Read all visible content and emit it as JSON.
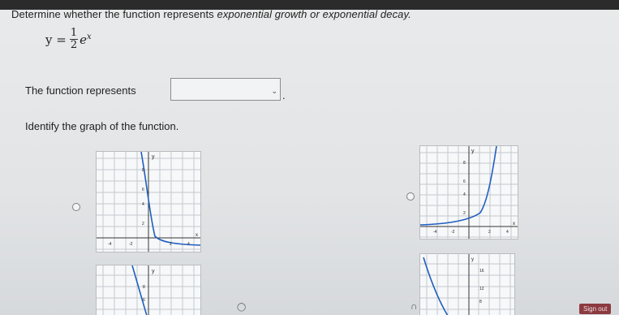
{
  "prompt": {
    "text_before": "Determine whether the function represents ",
    "text_em": "exponential growth or exponential decay."
  },
  "equation": {
    "lhs": "y =",
    "numerator": "1",
    "denominator": "2",
    "base": "e",
    "exponent": "x"
  },
  "statement": {
    "text": "The function represents",
    "answer_value": "",
    "period": "."
  },
  "identify_label": "Identify the graph of the function.",
  "graphs": [
    {
      "id": "A",
      "axis_labels": {
        "x": "x",
        "y": "y"
      },
      "y_ticks": [
        "8",
        "6",
        "4",
        "2"
      ],
      "x_ticks": [
        "-4",
        "-2",
        "2",
        "4"
      ]
    },
    {
      "id": "B",
      "axis_labels": {
        "x": "x",
        "y": "y"
      },
      "y_ticks": [
        "8",
        "6",
        "4",
        "2"
      ],
      "x_ticks": [
        "-4",
        "-2",
        "2",
        "4"
      ]
    },
    {
      "id": "C",
      "axis_labels": {
        "y": "y"
      },
      "y_ticks": [
        "8",
        "6"
      ]
    },
    {
      "id": "D",
      "axis_labels": {
        "y": "y"
      },
      "y_ticks": [
        "16",
        "12",
        "8"
      ]
    }
  ],
  "footer": {
    "signout_label": "Sign out"
  },
  "colors": {
    "curve": "#1f5fbf",
    "grid": "#c3c9d0",
    "signout_bg": "#8b3a40"
  },
  "icons": [
    "chevron-down-icon",
    "radio-icon",
    "cursor-icon"
  ]
}
